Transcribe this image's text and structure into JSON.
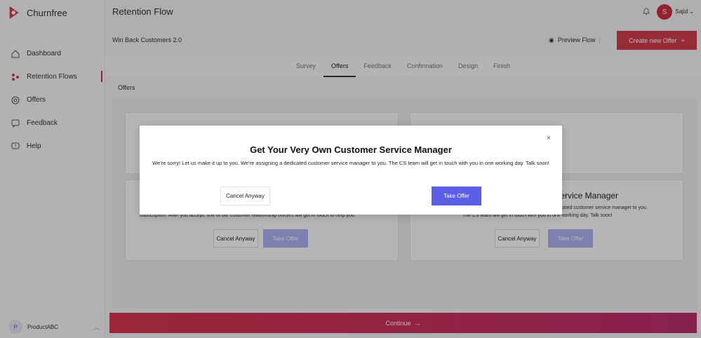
{
  "brand": {
    "name": "Churnfree",
    "color": "#d23d4e"
  },
  "sidebar": {
    "items": [
      {
        "label": "Dashboard",
        "icon": "home-icon"
      },
      {
        "label": "Retention Flows",
        "icon": "flow-icon"
      },
      {
        "label": "Offers",
        "icon": "offer-icon"
      },
      {
        "label": "Feedback",
        "icon": "feedback-icon"
      },
      {
        "label": "Help",
        "icon": "help-icon"
      }
    ],
    "account": {
      "initial": "P",
      "name": "ProductABC"
    }
  },
  "header": {
    "title": "Retention Flow",
    "user_initial": "S",
    "user_name": "Sajid"
  },
  "flow": {
    "name": "Win Back Customers 2.0",
    "preview_label": "Preview Flow",
    "create_label": "Create new Offer"
  },
  "tabs": [
    "Survey",
    "Offers",
    "Feedback",
    "Confirmation",
    "Design",
    "Finish"
  ],
  "section_title": "Offers",
  "cards": [
    {
      "text": "subscription. After you accept, one of our customer relationship officers will get in touch to help you.",
      "cancel_label": "Cancel Anyway",
      "take_label": "Take Offer"
    },
    {
      "title": "r Service Manager",
      "text_line1": "dedicated customer service manager to you.",
      "text_line2": "The CS team will get in touch with you in one working day. Talk soon!",
      "cancel_label": "Cancel Anyway",
      "take_label": "Take Offer"
    }
  ],
  "continue_label": "Continue",
  "modal": {
    "title": "Get Your Very Own Customer Service Manager",
    "text": "We're sorry! Let us make it up to you. We're assigning a dedicated customer service manager to you. The CS team will get in touch with you in one working day. Talk soon!",
    "cancel_label": "Cancel Anyway",
    "take_label": "Take Offer",
    "accent": "#5b5fe8"
  }
}
